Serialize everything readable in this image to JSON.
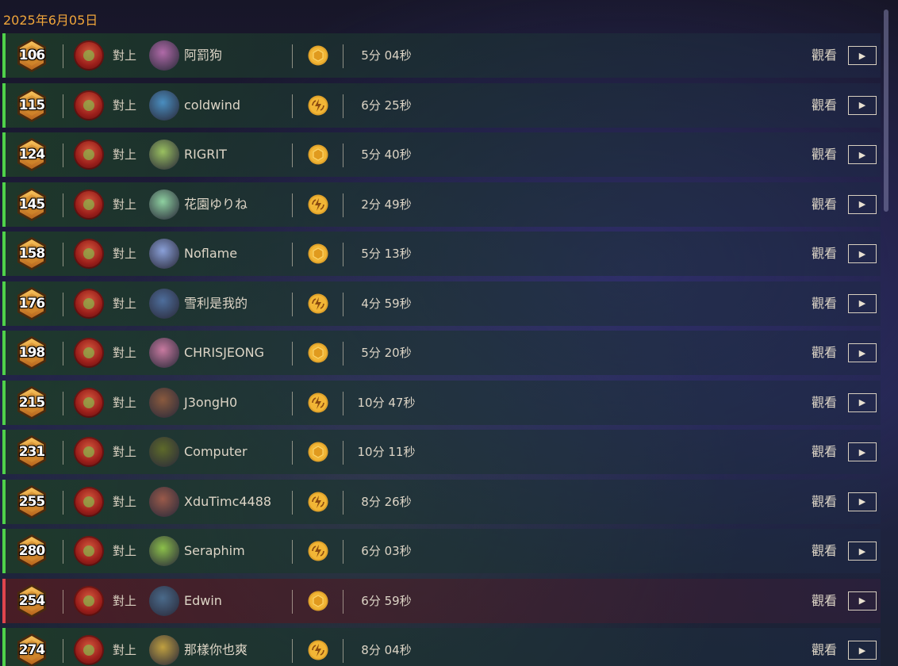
{
  "date_header": "2025年6月05日",
  "vs_label": "對上",
  "watch_label": "觀看",
  "colors": {
    "win": "#4fd14a",
    "loss": "#e0454d",
    "accent": "#f0a53a"
  },
  "matches": [
    {
      "rank": "106",
      "result": "win",
      "opponent": "阿罰狗",
      "coin": "hexagon-coin-icon",
      "duration": "5分 04秒",
      "avatar_color": "#b06aa8"
    },
    {
      "rank": "115",
      "result": "win",
      "opponent": "coldwind",
      "coin": "swirl-coin-icon",
      "duration": "6分 25秒",
      "avatar_color": "#4a8ec0"
    },
    {
      "rank": "124",
      "result": "win",
      "opponent": "RIGRIT",
      "coin": "hexagon-coin-icon",
      "duration": "5分 40秒",
      "avatar_color": "#9ac060"
    },
    {
      "rank": "145",
      "result": "win",
      "opponent": "花園ゆりね",
      "coin": "swirl-coin-icon",
      "duration": "2分 49秒",
      "avatar_color": "#8ed0a0"
    },
    {
      "rank": "158",
      "result": "win",
      "opponent": "Noflame",
      "coin": "hexagon-coin-icon",
      "duration": "5分 13秒",
      "avatar_color": "#8aa0d8"
    },
    {
      "rank": "176",
      "result": "win",
      "opponent": "雪利是我的",
      "coin": "swirl-coin-icon",
      "duration": "4分 59秒",
      "avatar_color": "#4e6e9c"
    },
    {
      "rank": "198",
      "result": "win",
      "opponent": "CHRISJEONG",
      "coin": "hexagon-coin-icon",
      "duration": "5分 20秒",
      "avatar_color": "#c87aa0"
    },
    {
      "rank": "215",
      "result": "win",
      "opponent": "J3ongH0",
      "coin": "swirl-coin-icon",
      "duration": "10分 47秒",
      "avatar_color": "#8a5a3e"
    },
    {
      "rank": "231",
      "result": "win",
      "opponent": "Computer",
      "coin": "hexagon-coin-icon",
      "duration": "10分 11秒",
      "avatar_color": "#5e6a2a"
    },
    {
      "rank": "255",
      "result": "win",
      "opponent": "XduTimc4488",
      "coin": "swirl-coin-icon",
      "duration": "8分 26秒",
      "avatar_color": "#9a5a4a"
    },
    {
      "rank": "280",
      "result": "win",
      "opponent": "Seraphim",
      "coin": "swirl-coin-icon",
      "duration": "6分 03秒",
      "avatar_color": "#8cc04a"
    },
    {
      "rank": "254",
      "result": "loss",
      "opponent": "Edwin",
      "coin": "hexagon-coin-icon",
      "duration": "6分 59秒",
      "avatar_color": "#4a6a8a"
    },
    {
      "rank": "274",
      "result": "win",
      "opponent": "那樣你也爽",
      "coin": "swirl-coin-icon",
      "duration": "8分 04秒",
      "avatar_color": "#c0a040"
    }
  ]
}
